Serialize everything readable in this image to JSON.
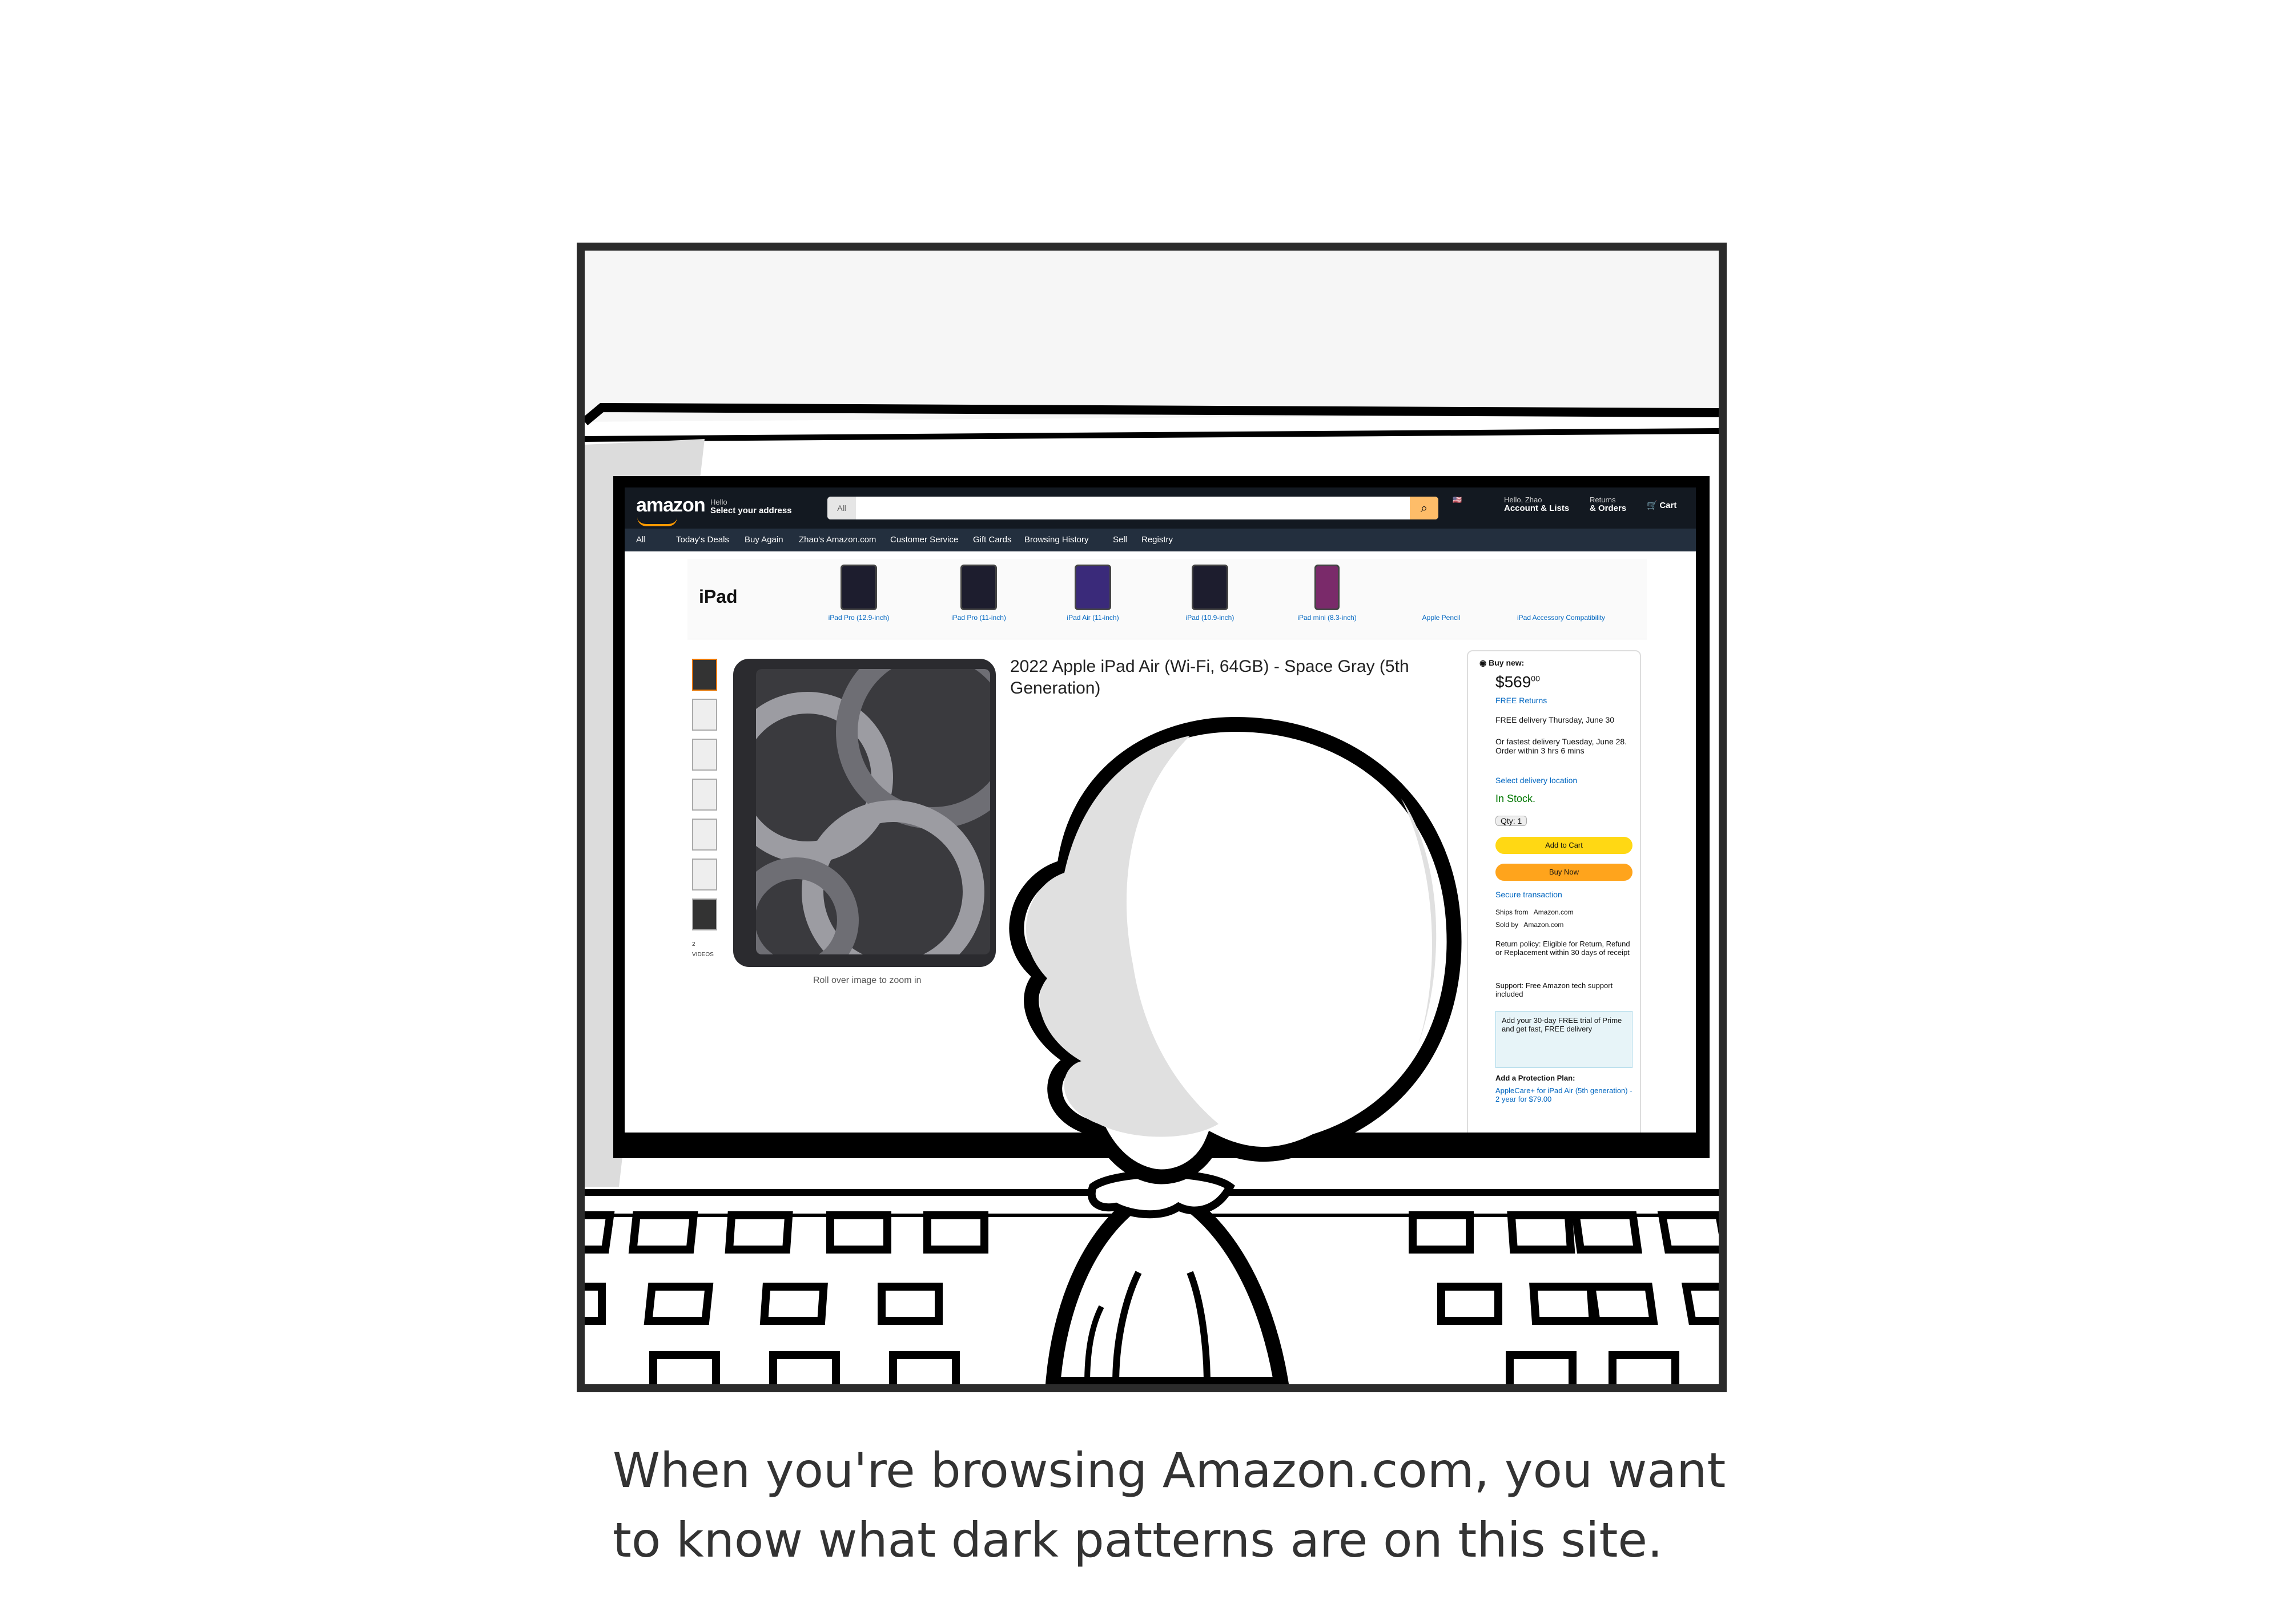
{
  "caption": "When you're browsing Amazon.com, you want to know what dark patterns are on this site.",
  "amazon": {
    "logo": "amazon",
    "deliver_small": "Hello",
    "deliver_label": "Select your address",
    "search_scope": "All",
    "nav_account_small": "Hello, Zhao",
    "nav_account": "Account & Lists",
    "nav_returns_small": "Returns",
    "nav_returns": "& Orders",
    "nav_cart": "Cart",
    "nav2": [
      "All",
      "Today's Deals",
      "Buy Again",
      "Zhao's Amazon.com",
      "Customer Service",
      "Gift Cards",
      "Browsing History",
      "Sell",
      "Registry"
    ],
    "category_title": "iPad",
    "category_items": [
      "iPad Pro (12.9-inch)",
      "iPad Pro (11-inch)",
      "iPad Air (11-inch)",
      "iPad (10.9-inch)",
      "iPad mini (8.3-inch)",
      "Apple Pencil",
      "iPad Accessory Compatibility"
    ],
    "gallery_videos": "2 VIDEOS",
    "roll_over": "Roll over image to zoom in",
    "product_title": "2022 Apple iPad Air (Wi-Fi, 64GB) - Space Gray (5th Generation)",
    "buy_new": "Buy new:",
    "price": "$569",
    "price_cents": "00",
    "free_returns": "FREE Returns",
    "free_delivery": "FREE delivery Thursday, June 30",
    "fastest_delivery": "Or fastest delivery Tuesday, June 28. Order within 3 hrs 6 mins",
    "delivery_location": "Select delivery location",
    "in_stock": "In Stock.",
    "qty": "Qty: 1",
    "add_to_cart": "Add to Cart",
    "buy_now": "Buy Now",
    "secure": "Secure transaction",
    "ships_from_label": "Ships from",
    "ships_from": "Amazon.com",
    "sold_by_label": "Sold by",
    "sold_by": "Amazon.com",
    "return_policy": "Return policy: Eligible for Return, Refund or Replacement within 30 days of receipt",
    "support": "Support: Free Amazon tech support included",
    "prime_offer": "Add your 30-day FREE trial of Prime and get fast, FREE delivery",
    "protection_title": "Add a Protection Plan:",
    "protection_item": "AppleCare+ for iPad Air (5th generation) - 2 year for $79.00"
  },
  "colors": {
    "amazon_nav": "#131921",
    "amazon_subnav": "#232f3e",
    "add_to_cart": "#ffd814",
    "buy_now": "#ffa41c",
    "panel_border": "#2b2b2b",
    "caption_text": "#333333"
  }
}
